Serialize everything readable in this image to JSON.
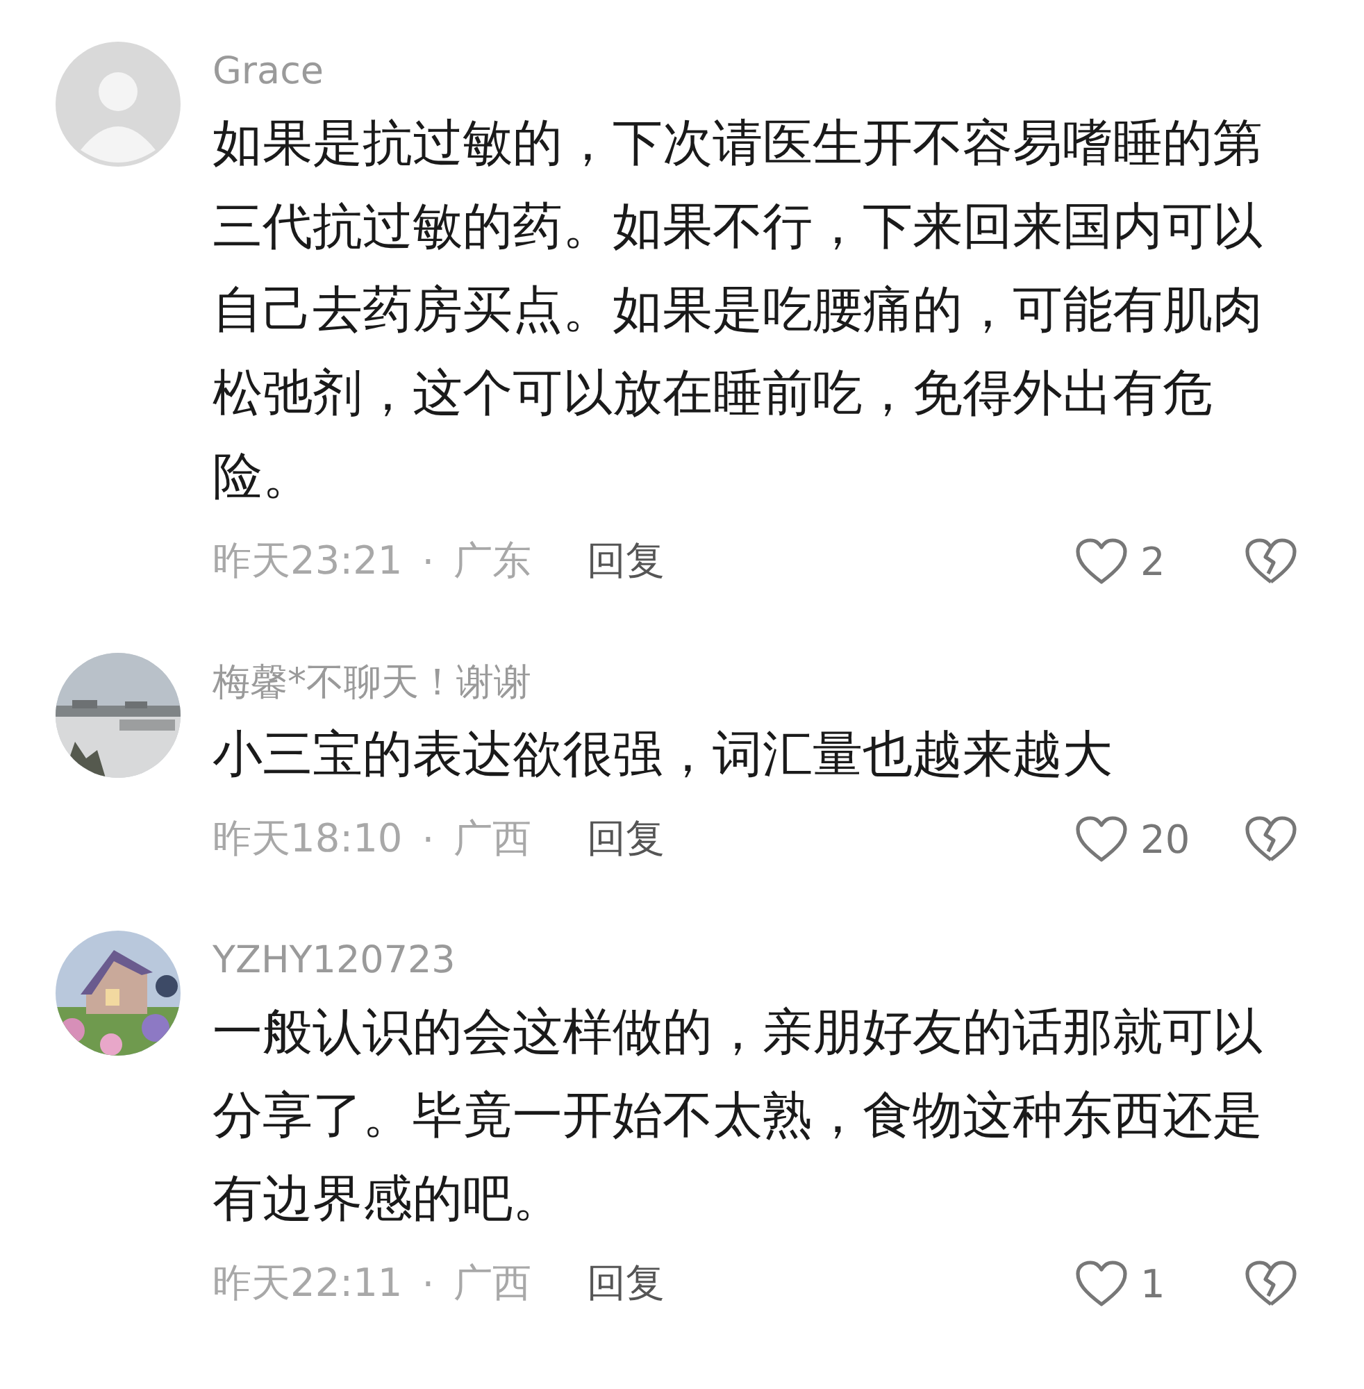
{
  "comments": [
    {
      "avatar": {
        "kind": "default"
      },
      "name": "Grace",
      "text": "如果是抗过敏的，下次请医生开不容易嗜睡的第三代抗过敏的药。如果不行，下来回来国内可以自己去药房买点。如果是吃腰痛的，可能有肌肉松弛剂，这个可以放在睡前吃，免得外出有危险。",
      "time": "昨天23:21",
      "separator": "·",
      "location": "广东",
      "reply": "回复",
      "likes": "2"
    },
    {
      "avatar": {
        "kind": "lake"
      },
      "name": "梅馨*不聊天！谢谢",
      "text": "小三宝的表达欲很强，词汇量也越来越大",
      "time": "昨天18:10",
      "separator": "·",
      "location": "广西",
      "reply": "回复",
      "likes": "20"
    },
    {
      "avatar": {
        "kind": "house"
      },
      "name": "YZHY120723",
      "text": "一般认识的会这样做的，亲朋好友的话那就可以分享了。毕竟一开始不太熟，食物这种东西还是有边界感的吧。",
      "time": "昨天22:11",
      "separator": "·",
      "location": "广西",
      "reply": "回复",
      "likes": "1"
    }
  ]
}
